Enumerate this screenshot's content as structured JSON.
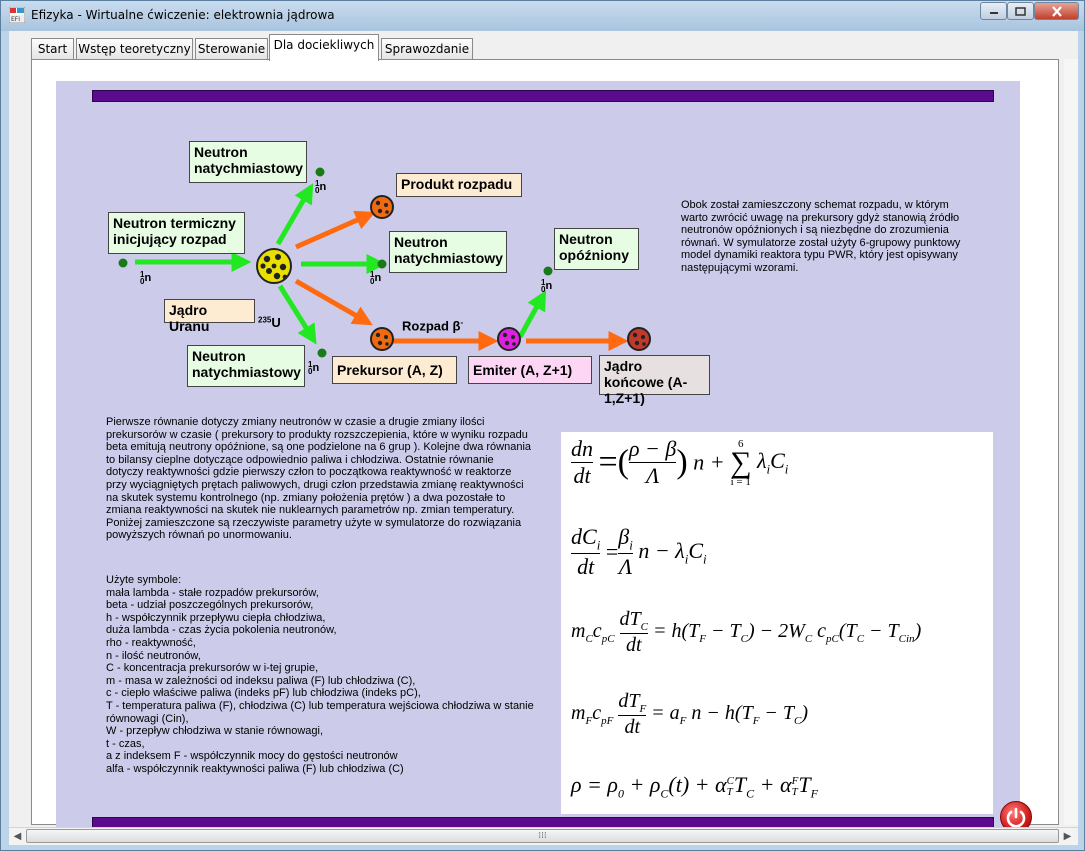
{
  "window": {
    "title": "Efizyka - Wirtualne ćwiczenie: elektrownia jądrowa",
    "controls": {
      "minimize": "minimize-icon",
      "maximize": "maximize-icon",
      "close": "close-icon"
    }
  },
  "tabs": [
    {
      "label": "Start",
      "active": false
    },
    {
      "label": "Wstęp teoretyczny",
      "active": false
    },
    {
      "label": "Sterowanie",
      "active": false
    },
    {
      "label": "Dla dociekliwych",
      "active": true
    },
    {
      "label": "Sprawozdanie",
      "active": false
    }
  ],
  "diagram": {
    "thermal_neutron": "Neutron termiczny inicjujący rozpad",
    "prompt_neutron": "Neutron natychmiastowy",
    "uranium_nucleus": "Jądro Uranu",
    "uranium_symbol": {
      "mass": "235",
      "element": "U"
    },
    "neutron_symbol": {
      "mass": "1",
      "charge": "0",
      "letter": "n"
    },
    "decay_product": "Produkt rozpadu",
    "delayed_neutron": "Neutron opóźniony",
    "beta_decay": {
      "text": "Rozpad β",
      "sup": "-"
    },
    "precursor": "Prekursor (A, Z)",
    "emitter": "Emiter (A, Z+1)",
    "final_nucleus": "Jądro końcowe (A-1,Z+1)"
  },
  "intro_text": "Obok został zamieszczony schemat rozpadu, w którym warto zwrócić uwagę na prekursory gdyż stanowią źródło neutronów opóźnionych i są niezbędne do zrozumienia równań. W symulatorze został użyty 6-grupowy punktowy model dynamiki reaktora typu PWR, który jest opisywany następującymi wzorami.",
  "description": "Pierwsze równanie dotyczy zmiany neutronów w czasie a drugie zmiany ilości prekursorów w czasie ( prekursory to produkty rozszczepienia, które w wyniku rozpadu beta emitują neutrony opóźnione, są one podzielone na 6 grup ). Kolejne dwa równania to bilansy cieplne dotyczące odpowiednio paliwa i chłodziwa. Ostatnie równanie dotyczy reaktywności gdzie pierwszy człon to początkowa reaktywność w reaktorze przy wyciągniętych prętach paliwowych, drugi człon przedstawia zmianę reaktywności na skutek systemu kontrolnego (np. zmiany położenia prętów ) a dwa pozostałe to zmiana reaktywności na skutek nie nuklearnych parametrów np. zmian temperatury. Poniżej zamieszczone są rzeczywiste parametry użyte w symulatorze do rozwiązania powyższych równań po unormowaniu.",
  "symbols_heading": "Użyte symbole:",
  "symbols": [
    "mała lambda - stałe rozpadów prekursorów,",
    "beta -  udział poszczególnych prekursorów,",
    "h - współczynnik przepływu ciepła chłodziwa,",
    "duża lambda - czas życia pokolenia neutronów,",
    "rho - reaktywność,",
    "n - ilość neutronów,",
    "C - koncentracja prekursorów w i-tej grupie,",
    "m - masa w zależności od indeksu paliwa (F) lub chłodziwa (C),",
    "c - ciepło właściwe paliwa (indeks pF) lub chłodziwa (indeks pC),",
    "T - temperatura paliwa (F), chłodziwa (C) lub temperatura wejściowa chłodziwa w stanie równowagi (Cin),",
    "W - przepływ chłodziwa w stanie równowagi,",
    "t - czas,",
    "a z indeksem F - współczynnik mocy do gęstości neutronów",
    "alfa - współczynnik reaktywności paliwa (F) lub chłodziwa (C)"
  ],
  "equations": {
    "eq1": {
      "lhs_num": "dn",
      "lhs_den": "dt",
      "frac_num": "ρ − β",
      "frac_den": "Λ",
      "rest": "n +",
      "sum_top": "6",
      "sum_bottom": "i = 1",
      "term": "λ",
      "term_sub": "i",
      "term2": "C",
      "term2_sub": "i"
    },
    "eq2": {
      "lhs_num": "dC",
      "lhs_num_sub": "i",
      "lhs_den": "dt",
      "frac_num": "β",
      "frac_num_sub": "i",
      "frac_den": "Λ",
      "rest": "n − λ",
      "rest_sub": "i",
      "rest2": "C",
      "rest2_sub": "i"
    },
    "eq3": {
      "text": "m",
      "m_sub": "C",
      "c": "c",
      "c_sub": "pC",
      "frac_num": "dT",
      "frac_num_sub": "C",
      "frac_den": "dt",
      "rhs": "= h(T",
      "rhs_sub1": "F",
      "rhs2": " − T",
      "rhs_sub2": "C",
      "rhs3": ") − 2W",
      "rhs_sub3": "C",
      "rhs4": " c",
      "rhs_sub4": "pC",
      "rhs5": "(T",
      "rhs_sub5": "C",
      "rhs6": " − T",
      "rhs_sub6": "Cin",
      "rhs7": ")"
    },
    "eq4": {
      "text": "m",
      "m_sub": "F",
      "c": "c",
      "c_sub": "pF",
      "frac_num": "dT",
      "frac_num_sub": "F",
      "frac_den": "dt",
      "rhs": "= a",
      "rhs_sub1": "F",
      "rhs2": " n − h(T",
      "rhs_sub2": "F",
      "rhs3": " − T",
      "rhs_sub3": "C",
      "rhs4": ")"
    },
    "eq5": {
      "a": "ρ = ρ",
      "a_sub": "0",
      "b": " + ρ",
      "b_sub": "C",
      "c": "(t) + α",
      "c_sup": "C",
      "c_sub": "T",
      "d": "T",
      "d_sub": "C",
      "e": " + α",
      "e_sup": "F",
      "e_sub": "T",
      "f": "T",
      "f_sub": "F"
    }
  },
  "power_button": "power-icon",
  "colors": {
    "content_bg": "#ccccea",
    "bar": "#5a0b8e",
    "green_arrow": "#22e822",
    "orange_arrow": "#ff6a10"
  }
}
